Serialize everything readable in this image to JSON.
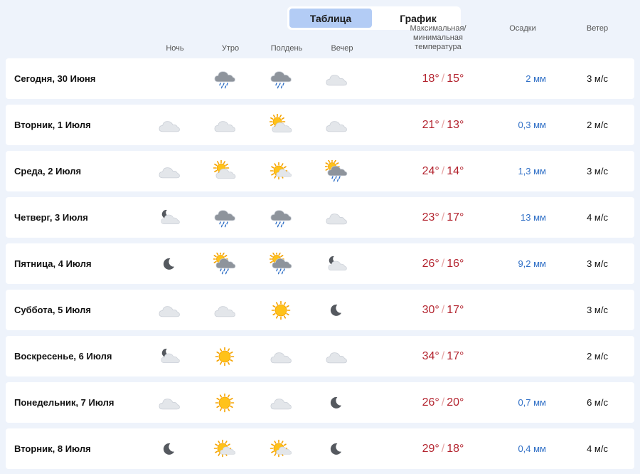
{
  "view_toggle": {
    "table_label": "Таблица",
    "chart_label": "График",
    "active": "table"
  },
  "headers": {
    "night": "Ночь",
    "morning": "Утро",
    "noon": "Полдень",
    "evening": "Вечер",
    "temperature": "Максимальная/ минимальная температура",
    "precipitation": "Осадки",
    "wind": "Ветер"
  },
  "days": [
    {
      "date": "Сегодня, 30 Июня",
      "icons": [
        "",
        "cloud-rain-icon",
        "cloud-rain-icon",
        "cloud-icon"
      ],
      "max": "18°",
      "min": "15°",
      "precip": "2 мм",
      "wind": "3 м/с"
    },
    {
      "date": "Вторник, 1 Июля",
      "icons": [
        "cloud-icon",
        "cloud-icon",
        "sun-cloud-icon",
        "cloud-icon"
      ],
      "max": "21°",
      "min": "13°",
      "precip": "0,3 мм",
      "wind": "2 м/с"
    },
    {
      "date": "Среда, 2 Июля",
      "icons": [
        "cloud-icon",
        "sun-cloud-icon",
        "sun-cloud-small-icon",
        "sun-cloud-rain-icon"
      ],
      "max": "24°",
      "min": "14°",
      "precip": "1,3 мм",
      "wind": "3 м/с"
    },
    {
      "date": "Четверг, 3 Июля",
      "icons": [
        "moon-cloud-icon",
        "cloud-rain-icon",
        "cloud-rain-icon",
        "cloud-icon"
      ],
      "max": "23°",
      "min": "17°",
      "precip": "13 мм",
      "wind": "4 м/с"
    },
    {
      "date": "Пятница, 4 Июля",
      "icons": [
        "moon-icon",
        "sun-cloud-rain-icon",
        "sun-cloud-rain-icon",
        "moon-cloud-icon"
      ],
      "max": "26°",
      "min": "16°",
      "precip": "9,2 мм",
      "wind": "3 м/с"
    },
    {
      "date": "Суббота, 5 Июля",
      "icons": [
        "cloud-icon",
        "cloud-icon",
        "sun-icon",
        "moon-icon"
      ],
      "max": "30°",
      "min": "17°",
      "precip": "",
      "wind": "3 м/с"
    },
    {
      "date": "Воскресенье, 6 Июля",
      "icons": [
        "moon-cloud-icon",
        "sun-icon",
        "cloud-icon",
        "cloud-icon"
      ],
      "max": "34°",
      "min": "17°",
      "precip": "",
      "wind": "2 м/с"
    },
    {
      "date": "Понедельник, 7 Июля",
      "icons": [
        "cloud-icon",
        "sun-icon",
        "cloud-icon",
        "moon-icon"
      ],
      "max": "26°",
      "min": "20°",
      "precip": "0,7 мм",
      "wind": "6 м/с"
    },
    {
      "date": "Вторник, 8 Июля",
      "icons": [
        "moon-icon",
        "sun-cloud-small-icon",
        "sun-cloud-small-icon",
        "moon-icon"
      ],
      "max": "29°",
      "min": "18°",
      "precip": "0,4 мм",
      "wind": "4 м/с"
    }
  ],
  "colors": {
    "temperature": "#b3232e",
    "precipitation": "#2f6fc6",
    "active_tab": "#b3ccf5",
    "background": "#eef3fb"
  }
}
